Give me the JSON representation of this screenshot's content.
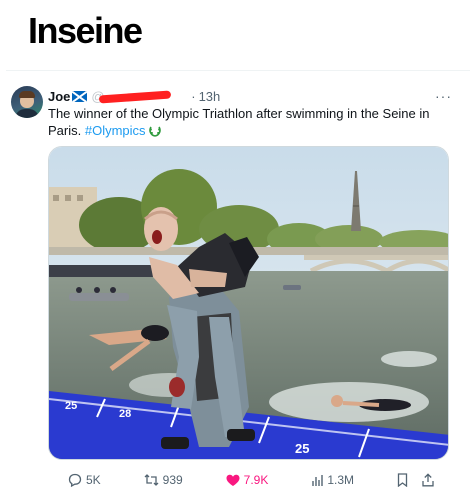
{
  "meme_title": "Inseine",
  "tweet": {
    "author_name": "Joe",
    "author_flag_icon": "scotland-flag-icon",
    "handle": "@",
    "time": "13h",
    "separator": "·",
    "more_label": "···",
    "text": "The winner of the Olympic Triathlon after swimming in the Seine in Paris.",
    "hashtag": "#Olympics",
    "media": {
      "lane_numbers": [
        "25",
        "28",
        "25"
      ]
    },
    "actions": {
      "replies": "5K",
      "reposts": "939",
      "likes": "7.9K",
      "views": "1.3M"
    }
  },
  "colors": {
    "accent": "#1d9bf0",
    "like": "#f91880",
    "muted": "#536471",
    "redaction": "#ff2020",
    "pontoon": "#2a3ad0"
  }
}
